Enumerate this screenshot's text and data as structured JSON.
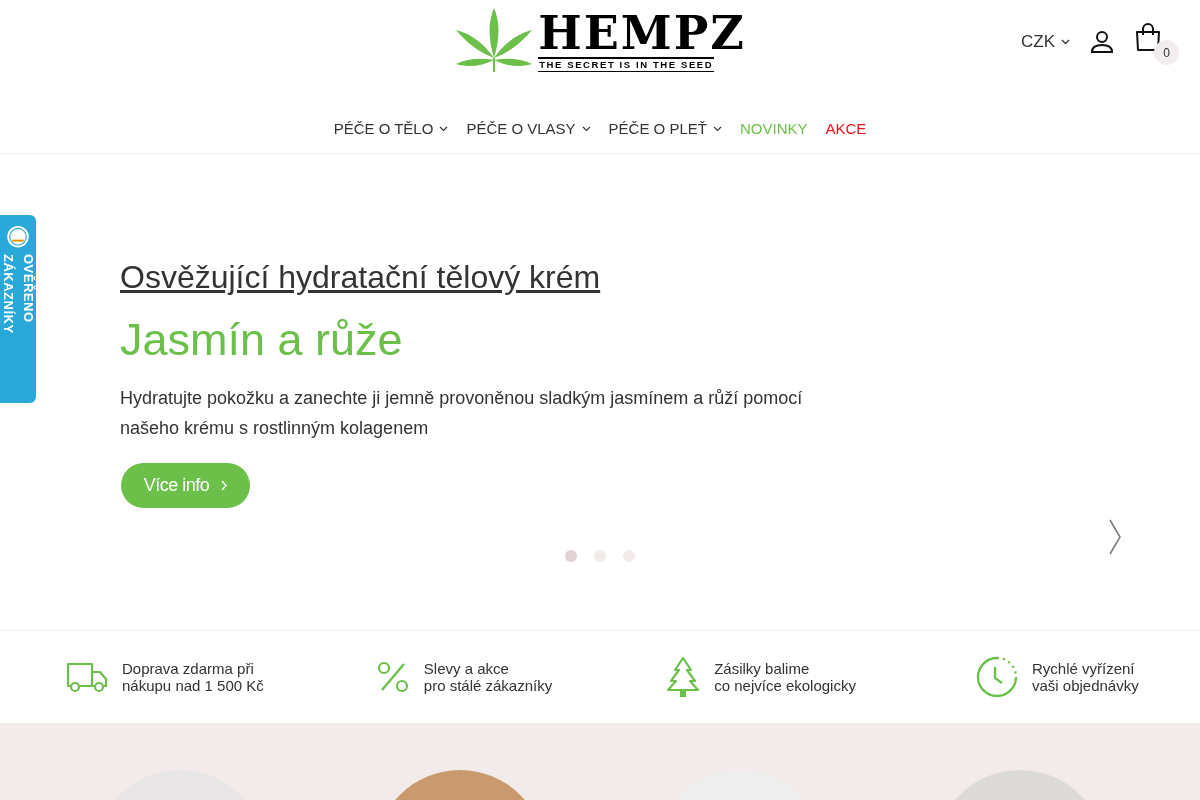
{
  "header": {
    "logo": {
      "wordmark": "HEMPZ",
      "tagline": "THE SECRET IS IN THE SEED"
    },
    "currency": "CZK",
    "cart_count": "0"
  },
  "nav": [
    {
      "label": "PÉČE O TĚLO",
      "kind": "dropdown"
    },
    {
      "label": "PÉČE O VLASY",
      "kind": "dropdown"
    },
    {
      "label": "PÉČE O PLEŤ",
      "kind": "dropdown"
    },
    {
      "label": "NOVINKY",
      "kind": "new"
    },
    {
      "label": "AKCE",
      "kind": "sale"
    }
  ],
  "badge": {
    "label": "OVĚŘENO ZÁKAZNÍKY"
  },
  "slide": {
    "kicker": "Osvěžující hydratační tělový krém",
    "title": "Jasmín a růže",
    "text": "Hydratujte pokožku a zanechte ji jemně provoněnou sladkým jasmínem a růží pomocí našeho krému s rostlinným kolagenem",
    "button": "Více info"
  },
  "slider_dots": [
    {
      "selected": true
    },
    {
      "selected": false
    },
    {
      "selected": false
    }
  ],
  "features": [
    {
      "kind": "truck",
      "lines": [
        "Doprava zdarma při",
        "nákupu nad 1 500 Kč"
      ]
    },
    {
      "kind": "percent",
      "lines": [
        "Slevy a akce",
        "pro stálé zákazníky"
      ]
    },
    {
      "kind": "tree",
      "lines": [
        "Zásilky balime",
        "co nejvíce ekologicky"
      ]
    },
    {
      "kind": "clock",
      "lines": [
        "Rychlé vyřízení",
        "vaši objednávky"
      ]
    }
  ],
  "categories": [
    {
      "kind": "photo"
    },
    {
      "kind": "photo"
    },
    {
      "kind": "photo"
    },
    {
      "kind": "photo"
    }
  ]
}
